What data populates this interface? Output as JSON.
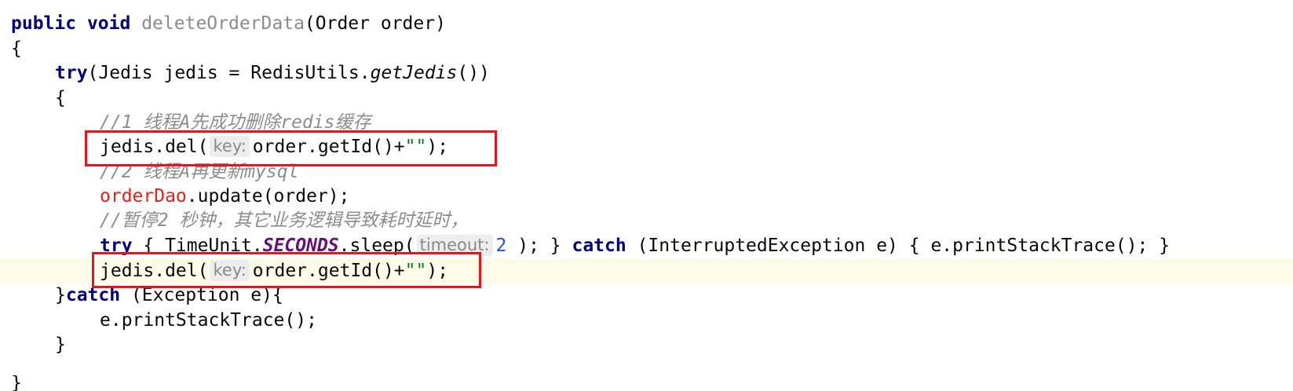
{
  "code": {
    "l1": {
      "public": "public",
      "void": "void",
      "method": "deleteOrderData",
      "params": "(Order order)"
    },
    "l2": {
      "brace": "{"
    },
    "l3": {
      "try": "try",
      "open": "(Jedis jedis = RedisUtils.",
      "call": "getJedis",
      "close": "())"
    },
    "l4": {
      "brace": "{"
    },
    "l5": {
      "comment": "//1 线程A先成功删除redis缓存"
    },
    "l6": {
      "pre": "jedis.del(",
      "hint": "key:",
      "post": "order.getId()+",
      "str": "\"\"",
      "end": ");"
    },
    "l7": {
      "comment": "//2 线程A再更新mysql"
    },
    "l8": {
      "field": "orderDao",
      "rest": ".update(order);"
    },
    "l9": {
      "comment": "//暂停2 秒钟，其它业务逻辑导致耗时延时，"
    },
    "l10": {
      "try": "try",
      "a": " { TimeUnit.",
      "const": "SECONDS",
      "b": ".sleep(",
      "hint": "timeout:",
      "num": "2",
      "c": " ); } ",
      "catch": "catch",
      "d": " (InterruptedException e) { e.printStackTrace(); }"
    },
    "l11": {
      "pre": "jedis.del(",
      "hint": "key:",
      "post": "order.getId()+",
      "str": "\"\"",
      "end": ");"
    },
    "l12": {
      "pre": "}",
      "catch": "catch",
      "post": " (Exception e){"
    },
    "l13": {
      "text": "e.printStackTrace();"
    },
    "l14": {
      "brace": "}"
    },
    "l15": {
      "brace": "}"
    }
  },
  "colors": {
    "keyword": "#000080",
    "comment": "#8c8c8c",
    "field": "#e0221b",
    "string": "#067d17",
    "number": "#1750eb",
    "highlight_box": "#e8141b",
    "current_line": "#fdfce8"
  }
}
